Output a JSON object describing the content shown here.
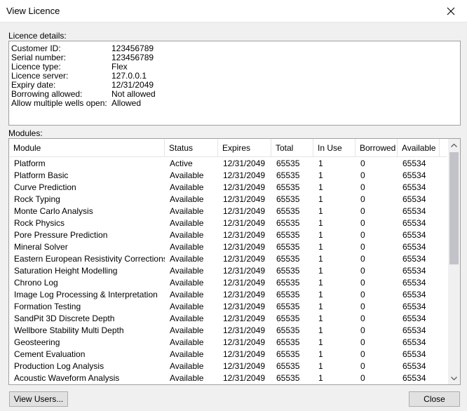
{
  "window": {
    "title": "View Licence",
    "close_icon": "close-icon"
  },
  "details": {
    "label": "Licence details:",
    "items": [
      {
        "label": "Customer ID:",
        "value": "123456789"
      },
      {
        "label": "Serial number:",
        "value": "123456789"
      },
      {
        "label": "Licence type:",
        "value": "Flex"
      },
      {
        "label": "Licence server:",
        "value": "127.0.0.1"
      },
      {
        "label": "Expiry date:",
        "value": "12/31/2049"
      },
      {
        "label": "Borrowing allowed:",
        "value": "Not allowed"
      },
      {
        "label": "Allow multiple wells open:",
        "value": "Allowed"
      }
    ]
  },
  "modules": {
    "label": "Modules:",
    "columns": [
      "Module",
      "Status",
      "Expires",
      "Total",
      "In Use",
      "Borrowed",
      "Available"
    ],
    "rows": [
      [
        "Platform",
        "Active",
        "12/31/2049",
        "65535",
        "1",
        "0",
        "65534"
      ],
      [
        "Platform Basic",
        "Available",
        "12/31/2049",
        "65535",
        "1",
        "0",
        "65534"
      ],
      [
        "Curve Prediction",
        "Available",
        "12/31/2049",
        "65535",
        "1",
        "0",
        "65534"
      ],
      [
        "Rock Typing",
        "Available",
        "12/31/2049",
        "65535",
        "1",
        "0",
        "65534"
      ],
      [
        "Monte Carlo Analysis",
        "Available",
        "12/31/2049",
        "65535",
        "1",
        "0",
        "65534"
      ],
      [
        "Rock Physics",
        "Available",
        "12/31/2049",
        "65535",
        "1",
        "0",
        "65534"
      ],
      [
        "Pore Pressure Prediction",
        "Available",
        "12/31/2049",
        "65535",
        "1",
        "0",
        "65534"
      ],
      [
        "Mineral Solver",
        "Available",
        "12/31/2049",
        "65535",
        "1",
        "0",
        "65534"
      ],
      [
        "Eastern European Resistivity Corrections",
        "Available",
        "12/31/2049",
        "65535",
        "1",
        "0",
        "65534"
      ],
      [
        "Saturation Height Modelling",
        "Available",
        "12/31/2049",
        "65535",
        "1",
        "0",
        "65534"
      ],
      [
        "Chrono Log",
        "Available",
        "12/31/2049",
        "65535",
        "1",
        "0",
        "65534"
      ],
      [
        "Image Log Processing & Interpretation",
        "Available",
        "12/31/2049",
        "65535",
        "1",
        "0",
        "65534"
      ],
      [
        "Formation Testing",
        "Available",
        "12/31/2049",
        "65535",
        "1",
        "0",
        "65534"
      ],
      [
        "SandPit 3D Discrete Depth",
        "Available",
        "12/31/2049",
        "65535",
        "1",
        "0",
        "65534"
      ],
      [
        "Wellbore Stability Multi Depth",
        "Available",
        "12/31/2049",
        "65535",
        "1",
        "0",
        "65534"
      ],
      [
        "Geosteering",
        "Available",
        "12/31/2049",
        "65535",
        "1",
        "0",
        "65534"
      ],
      [
        "Cement Evaluation",
        "Available",
        "12/31/2049",
        "65535",
        "1",
        "0",
        "65534"
      ],
      [
        "Production Log Analysis",
        "Available",
        "12/31/2049",
        "65535",
        "1",
        "0",
        "65534"
      ],
      [
        "Acoustic Waveform Analysis",
        "Available",
        "12/31/2049",
        "65535",
        "1",
        "0",
        "65534"
      ]
    ]
  },
  "buttons": {
    "view_users": "View Users...",
    "close": "Close"
  },
  "icons": {
    "scroll_up": "chevron-up-icon",
    "scroll_down": "chevron-down-icon"
  }
}
